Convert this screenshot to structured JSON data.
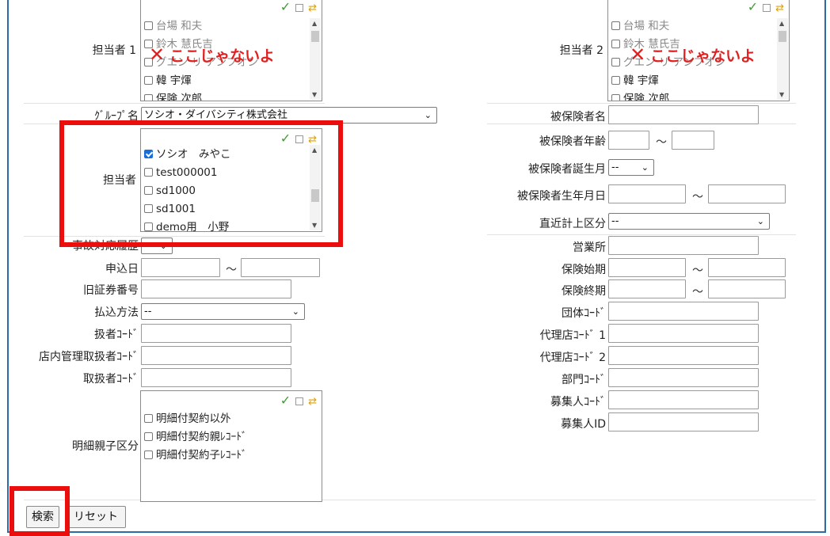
{
  "top_left": {
    "label": "担当者 1",
    "items": [
      "台場 和夫",
      "鈴木 慧氏吉",
      "グエン リ アンフオン",
      "韓 宇煇",
      "保険 次郎"
    ],
    "warning": "ここじゃないよ"
  },
  "top_right": {
    "label": "担当者 2",
    "items": [
      "台場 和夫",
      "鈴木 慧氏吉",
      "グエン リ アンフオン",
      "韓 宇煇",
      "保険 次郎"
    ],
    "warning": "ここじゃないよ"
  },
  "warning_mark": "✕",
  "left": {
    "group_label": "ｸﾞﾙｰﾌﾟ名",
    "group_value": "ソシオ・ダイバシティ株式会社",
    "tanto_label": "担当者",
    "tanto_items": [
      {
        "text": "ソシオ　みやこ",
        "checked": true
      },
      {
        "text": "test000001",
        "checked": false
      },
      {
        "text": "sd1000",
        "checked": false
      },
      {
        "text": "sd1001",
        "checked": false
      },
      {
        "text": "demo用　小野",
        "checked": false
      }
    ],
    "history_label": "事故対応履歴",
    "history_value": "--",
    "moshikomi_label": "申込日",
    "kyu_label": "旧証券番号",
    "haraikomi_label": "払込方法",
    "haraikomi_value": "--",
    "atsukaisha_label": "扱者ｺｰﾄﾞ",
    "tennai_label": "店内管理取扱者ｺｰﾄﾞ",
    "toriatsukai_label": "取扱者ｺｰﾄﾞ",
    "meisai_label": "明細親子区分",
    "meisai_items": [
      "明細付契約以外",
      "明細付契約親ﾚｺｰﾄﾞ",
      "明細付契約子ﾚｺｰﾄﾞ"
    ]
  },
  "right": {
    "hihoken_name": "被保険者名",
    "hihoken_age": "被保険者年齢",
    "hihoken_birthmonth": "被保険者誕生月",
    "birthmonth_value": "--",
    "hihoken_birthdate": "被保険者生年月日",
    "chokkin_label": "直近計上区分",
    "chokkin_value": "--",
    "eigyosho": "営業所",
    "hoken_shiki": "保険始期",
    "hoken_shuki": "保険終期",
    "dantai": "団体ｺｰﾄﾞ",
    "dairi1": "代理店ｺｰﾄﾞ 1",
    "dairi2": "代理店ｺｰﾄﾞ 2",
    "bumon": "部門ｺｰﾄﾞ",
    "boshu_code": "募集人ｺｰﾄﾞ",
    "boshu_id": "募集人ID"
  },
  "tilde": "～",
  "buttons": {
    "search": "検索",
    "reset": "リセット"
  }
}
